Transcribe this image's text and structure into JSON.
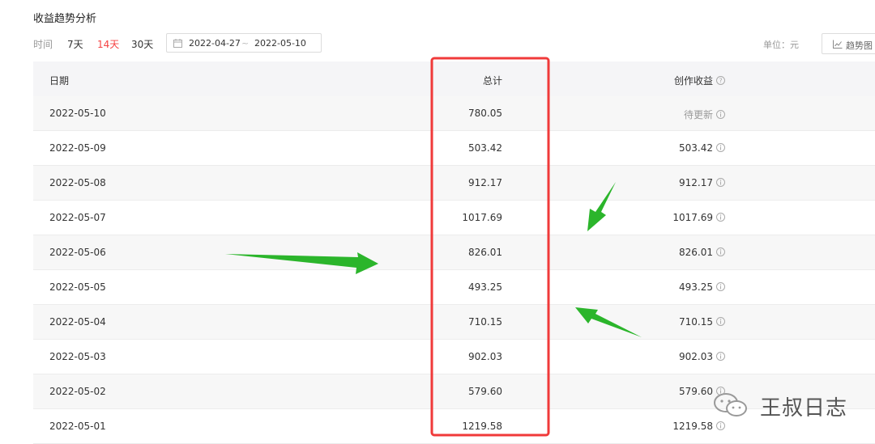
{
  "page": {
    "title": "收益趋势分析"
  },
  "filter": {
    "label": "时间",
    "options": [
      "7天",
      "14天",
      "30天"
    ],
    "active": "14天",
    "start_date": "2022-04-27",
    "separator": "~",
    "end_date": "2022-05-10"
  },
  "unit_label": "单位：元",
  "trend_button": "趋势图",
  "table": {
    "headers": {
      "date": "日期",
      "total": "总计",
      "income": "创作收益"
    },
    "rows": [
      {
        "date": "2022-05-10",
        "total": "780.05",
        "income": "待更新"
      },
      {
        "date": "2022-05-09",
        "total": "503.42",
        "income": "503.42"
      },
      {
        "date": "2022-05-08",
        "total": "912.17",
        "income": "912.17"
      },
      {
        "date": "2022-05-07",
        "total": "1017.69",
        "income": "1017.69"
      },
      {
        "date": "2022-05-06",
        "total": "826.01",
        "income": "826.01"
      },
      {
        "date": "2022-05-05",
        "total": "493.25",
        "income": "493.25"
      },
      {
        "date": "2022-05-04",
        "total": "710.15",
        "income": "710.15"
      },
      {
        "date": "2022-05-03",
        "total": "902.03",
        "income": "902.03"
      },
      {
        "date": "2022-05-02",
        "total": "579.60",
        "income": "579.60"
      },
      {
        "date": "2022-05-01",
        "total": "1219.58",
        "income": "1219.58"
      }
    ]
  },
  "annotation": {
    "highlight_color": "#f03a3a",
    "arrow_color": "#2bb52b"
  },
  "watermark": {
    "text": "王叔日志",
    "icon": "wechat-icon"
  }
}
